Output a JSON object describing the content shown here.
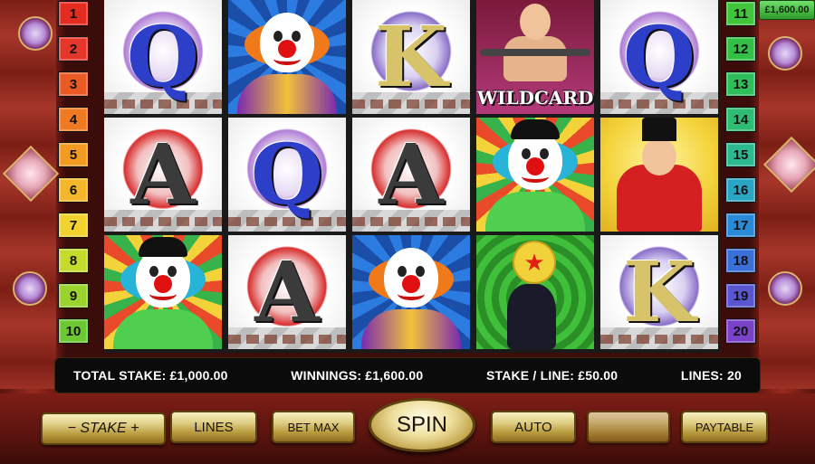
{
  "balance": "£1,600.00",
  "left_lines": [
    {
      "n": "1",
      "color": "#e42b1f"
    },
    {
      "n": "2",
      "color": "#e5362a"
    },
    {
      "n": "3",
      "color": "#ea5a24"
    },
    {
      "n": "4",
      "color": "#ef7a22"
    },
    {
      "n": "5",
      "color": "#f39a22"
    },
    {
      "n": "6",
      "color": "#f4b62a"
    },
    {
      "n": "7",
      "color": "#f2d22e"
    },
    {
      "n": "8",
      "color": "#c6da2e"
    },
    {
      "n": "9",
      "color": "#9ad22e"
    },
    {
      "n": "10",
      "color": "#6cc832"
    }
  ],
  "right_lines": [
    {
      "n": "11",
      "color": "#3fc43a"
    },
    {
      "n": "12",
      "color": "#34c046"
    },
    {
      "n": "13",
      "color": "#2fbf5a"
    },
    {
      "n": "14",
      "color": "#2dbd72"
    },
    {
      "n": "15",
      "color": "#2cb990"
    },
    {
      "n": "16",
      "color": "#2aa6c4"
    },
    {
      "n": "17",
      "color": "#2b8ad8"
    },
    {
      "n": "18",
      "color": "#3a6fd8"
    },
    {
      "n": "19",
      "color": "#5a55d0"
    },
    {
      "n": "20",
      "color": "#7a42c8"
    }
  ],
  "reels": [
    [
      "Q",
      "A",
      "clown-bowler"
    ],
    [
      "clown-bald",
      "Q",
      "A"
    ],
    [
      "K",
      "A",
      "clown-bald"
    ],
    [
      "wildcard-strongman",
      "clown-bowler",
      "seal"
    ],
    [
      "Q",
      "ringmaster",
      "K"
    ]
  ],
  "wildcard_label": "WILDCARD",
  "info": {
    "total_stake": "TOTAL STAKE: £1,000.00",
    "winnings": "WINNINGS: £1,600.00",
    "stake_line": "STAKE / LINE: £50.00",
    "lines": "LINES: 20"
  },
  "buttons": {
    "stake": "− STAKE +",
    "lines": "LINES",
    "bet_max": "BET MAX",
    "spin": "SPIN",
    "auto": "AUTO",
    "blank": "",
    "paytable": "PAYTABLE"
  },
  "colors": {
    "letter_q": "#2d3fc8",
    "letter_a": "#3b3b3b",
    "letter_k": "#d7c36a",
    "clown_suit_green": "#4fce4f",
    "ringmaster_red": "#d42020"
  }
}
